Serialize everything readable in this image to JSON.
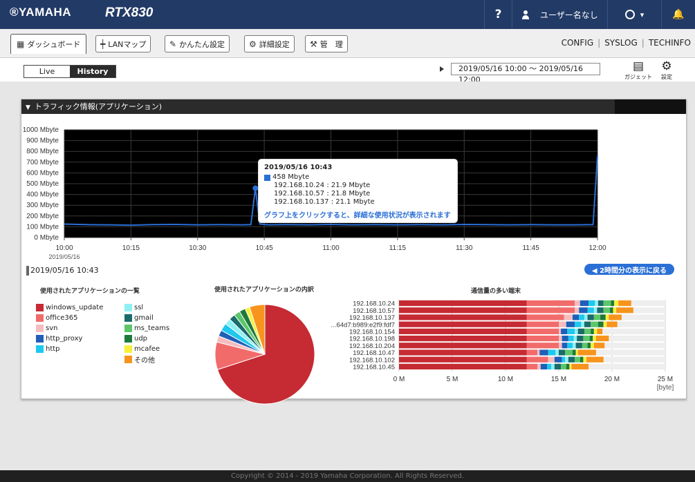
{
  "header": {
    "logo": "®YAMAHA",
    "model": "RTX830",
    "help": "?",
    "user": "ユーザー名なし",
    "status_caret": "▾",
    "bell": "🔔"
  },
  "tabs": [
    {
      "label": "ダッシュボード",
      "icon": "dashboard-icon",
      "glyph": "▦"
    },
    {
      "label": "LANマップ",
      "icon": "lanmap-icon",
      "glyph": "┿"
    },
    {
      "label": "かんたん設定",
      "icon": "wizard-icon",
      "glyph": "✎"
    },
    {
      "label": "詳細設定",
      "icon": "gear-icon",
      "glyph": "⚙"
    },
    {
      "label": "管　理",
      "icon": "wrench-icon",
      "glyph": "⚒"
    }
  ],
  "toplinks": [
    "CONFIG",
    "SYSLOG",
    "TECHINFO"
  ],
  "mode": {
    "live": "Live",
    "history": "History"
  },
  "date_range": "2019/05/16 10:00 ～ 2019/05/16 12:00",
  "tools": {
    "gadget": "ガジェット",
    "settings": "設定"
  },
  "panel": {
    "title": "トラフィック情報(アプリケーション)",
    "selected_time": "2019/05/16 10:43",
    "back_button": "◀ 2時間分の表示に戻る"
  },
  "tooltip": {
    "title": "2019/05/16 10:43",
    "total": "458 Mbyte",
    "rows": [
      "192.168.10.24 : 21.9 Mbyte",
      "192.168.10.57 : 21.8 Mbyte",
      "192.168.10.137 : 21.1 Mbyte"
    ],
    "hint": "グラフ上をクリックすると、詳細な使用状況が表示されます"
  },
  "sections": {
    "app_list": "使用されたアプリケーションの一覧",
    "app_breakdown": "使用されたアプリケーションの内訳",
    "top_hosts": "通信量の多い端末"
  },
  "legend": [
    {
      "name": "windows_update",
      "color": "#c62a33"
    },
    {
      "name": "office365",
      "color": "#f26b6b"
    },
    {
      "name": "svn",
      "color": "#f6bcc0"
    },
    {
      "name": "http_proxy",
      "color": "#1f5fb8"
    },
    {
      "name": "http",
      "color": "#1ec8ef"
    },
    {
      "name": "ssl",
      "color": "#8ff0f4"
    },
    {
      "name": "gmail",
      "color": "#1b6b6b"
    },
    {
      "name": "ms_teams",
      "color": "#5cc76a"
    },
    {
      "name": "udp",
      "color": "#1e7a3a"
    },
    {
      "name": "mcafee",
      "color": "#f7f03a"
    },
    {
      "name": "その他",
      "color": "#f7941d"
    }
  ],
  "footer": "Copyright © 2014 - 2019 Yamaha Corporation. All Rights Reserved.",
  "chart_data": [
    {
      "type": "line",
      "title": "",
      "ylabel": "",
      "ylim": [
        0,
        1000
      ],
      "yticks": [
        "1000 Mbyte",
        "900 Mbyte",
        "800 Mbyte",
        "700 Mbyte",
        "600 Mbyte",
        "500 Mbyte",
        "400 Mbyte",
        "300 Mbyte",
        "200 Mbyte",
        "100 Mbyte",
        "0 Mbyte"
      ],
      "xticks": [
        "10:00",
        "10:15",
        "10:30",
        "10:45",
        "11:00",
        "11:15",
        "11:30",
        "11:45",
        "12:00"
      ],
      "xdate": "2019/05/16",
      "line_color": "#2a6fd6",
      "grid": true,
      "series": [
        {
          "x": [
            "10:00",
            "10:05",
            "10:10",
            "10:15",
            "10:20",
            "10:25",
            "10:30",
            "10:35",
            "10:40",
            "10:42",
            "10:43",
            "10:44",
            "10:46",
            "10:50",
            "10:55",
            "11:00",
            "11:05",
            "11:10",
            "11:15",
            "11:20",
            "11:25",
            "11:30",
            "11:35",
            "11:40",
            "11:45",
            "11:50",
            "11:55",
            "11:59",
            "12:00"
          ],
          "values": [
            125,
            120,
            118,
            115,
            120,
            122,
            118,
            120,
            118,
            120,
            458,
            125,
            118,
            120,
            118,
            122,
            118,
            120,
            118,
            120,
            118,
            122,
            120,
            118,
            120,
            118,
            118,
            120,
            760
          ]
        }
      ]
    },
    {
      "type": "pie",
      "title": "使用されたアプリケーションの内訳",
      "categories": [
        "windows_update",
        "office365",
        "svn",
        "http_proxy",
        "http",
        "ssl",
        "gmail",
        "ms_teams",
        "udp",
        "mcafee",
        "その他"
      ],
      "values": [
        70,
        9,
        2,
        2,
        2.5,
        2,
        2,
        2,
        2,
        1.5,
        5
      ]
    },
    {
      "type": "bar",
      "orientation": "horizontal",
      "stacked": true,
      "title": "通信量の多い端末",
      "xlim": [
        0,
        25
      ],
      "xticks": [
        "0 M",
        "5 M",
        "10 M",
        "15 M",
        "20 M",
        "25 M"
      ],
      "xunit": "[byte]",
      "categories": [
        "192.168.10.24",
        "192.168.10.57",
        "192.168.10.137",
        "...64d7:b989:e2f9:fdf7",
        "192.168.10.154",
        "192.168.10.198",
        "192.168.10.204",
        "192.168.10.47",
        "192.168.10.102",
        "192.168.10.45"
      ],
      "series": [
        {
          "name": "windows_update",
          "values": [
            12,
            12,
            12,
            12,
            12,
            12,
            12,
            12,
            12,
            12
          ]
        },
        {
          "name": "office365",
          "values": [
            4.5,
            4.5,
            3.5,
            3.0,
            3.0,
            3.0,
            3.0,
            1.0,
            2.0,
            1.0
          ]
        },
        {
          "name": "svn",
          "values": [
            0.5,
            0.4,
            0.8,
            0.7,
            0.2,
            0.3,
            0.3,
            0.2,
            0.6,
            0.3
          ]
        },
        {
          "name": "http_proxy",
          "values": [
            0.8,
            0.8,
            0.6,
            0.8,
            0.6,
            0.6,
            0.5,
            0.8,
            0.7,
            0.6
          ]
        },
        {
          "name": "http",
          "values": [
            0.6,
            0.6,
            0.5,
            0.6,
            0.7,
            0.5,
            0.5,
            0.7,
            0.3,
            0.4
          ]
        },
        {
          "name": "ssl",
          "values": [
            0.3,
            0.3,
            0.3,
            0.3,
            0.3,
            0.3,
            0.3,
            0.3,
            0.3,
            0.3
          ]
        },
        {
          "name": "gmail",
          "values": [
            0.5,
            0.6,
            0.6,
            0.6,
            0.6,
            0.6,
            0.6,
            0.6,
            0.6,
            0.6
          ]
        },
        {
          "name": "ms_teams",
          "values": [
            0.7,
            0.6,
            0.6,
            0.7,
            0.6,
            0.6,
            0.5,
            0.7,
            0.5,
            0.5
          ]
        },
        {
          "name": "udp",
          "values": [
            0.3,
            0.3,
            0.5,
            0.5,
            0.3,
            0.3,
            0.3,
            0.3,
            0.3,
            0.3
          ]
        },
        {
          "name": "mcafee",
          "values": [
            0.4,
            0.3,
            0.3,
            0.3,
            0.3,
            0.3,
            0.3,
            0.2,
            0.3,
            0.2
          ]
        },
        {
          "name": "その他",
          "values": [
            1.2,
            1.6,
            1.2,
            1.0,
            0.5,
            1.2,
            1.0,
            1.7,
            1.6,
            1.6
          ]
        }
      ]
    }
  ]
}
